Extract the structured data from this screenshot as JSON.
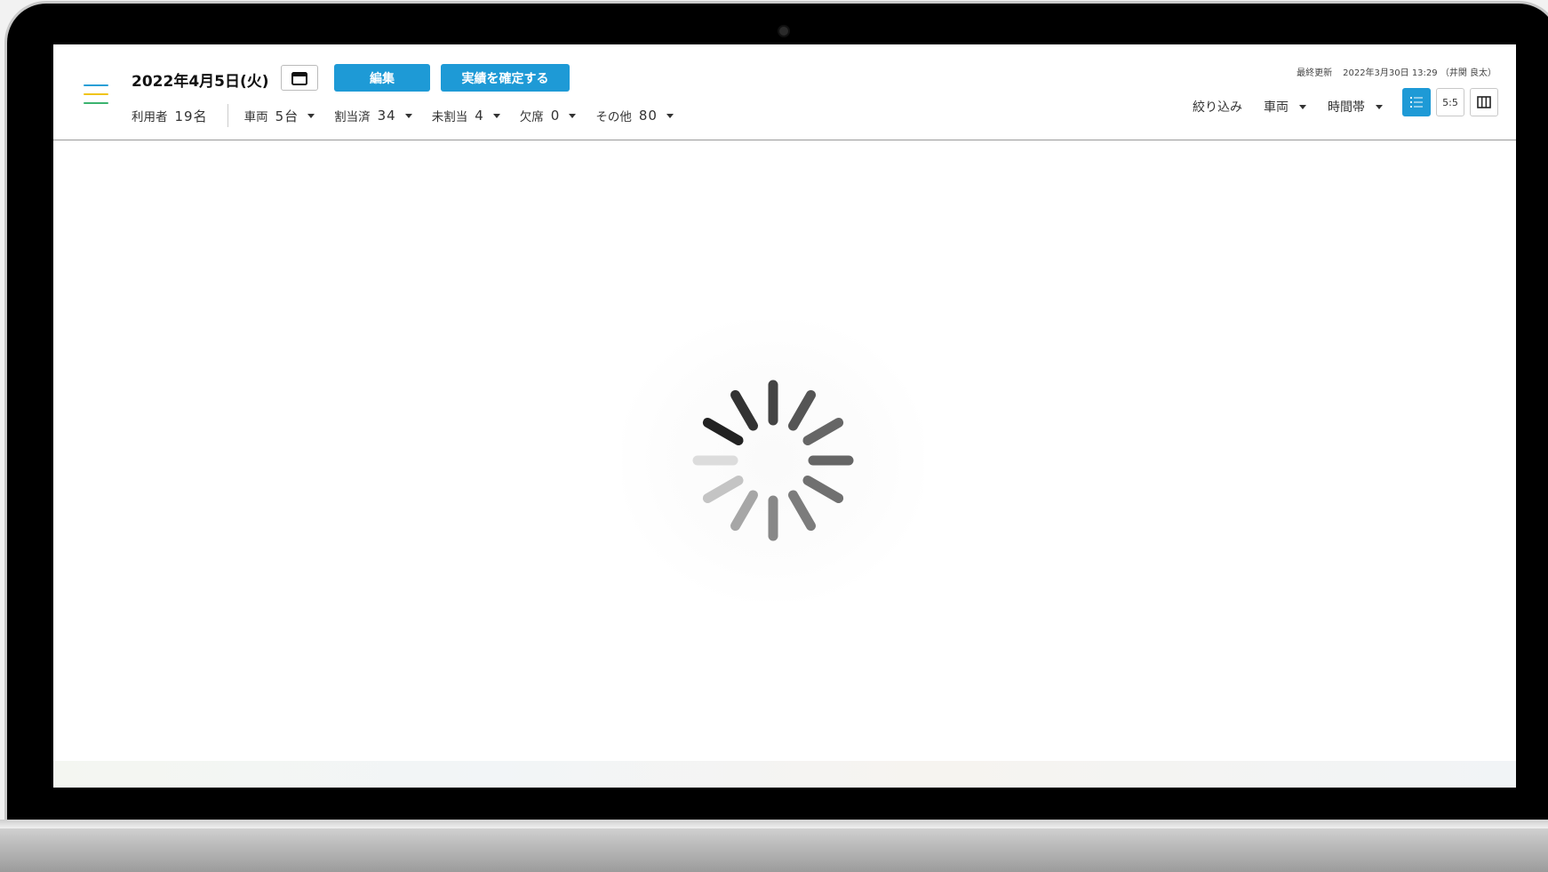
{
  "header": {
    "date": "2022年4月5日(火)",
    "edit_label": "編集",
    "confirm_label": "実績を確定する"
  },
  "stats": [
    {
      "label": "利用者",
      "value": "19名"
    },
    {
      "label": "車両",
      "value": "5台"
    },
    {
      "label": "割当済",
      "value": "34"
    },
    {
      "label": "未割当",
      "value": "4"
    },
    {
      "label": "欠席",
      "value": "0"
    },
    {
      "label": "その他",
      "value": "80"
    }
  ],
  "last_updated": {
    "label": "最終更新",
    "value": "2022年3月30日 13:29 （井関 良太）"
  },
  "filters": [
    "絞り込み",
    "車両",
    "時間帯"
  ],
  "view_toggle": {
    "icons": [
      "list-icon",
      "split-view-icon",
      "columns-icon"
    ],
    "split_label": "5:5"
  },
  "colors": {
    "accent": "#1e9ad6",
    "hamburger": [
      "#2a9fd6",
      "#f0c419",
      "#3bb36f"
    ]
  }
}
